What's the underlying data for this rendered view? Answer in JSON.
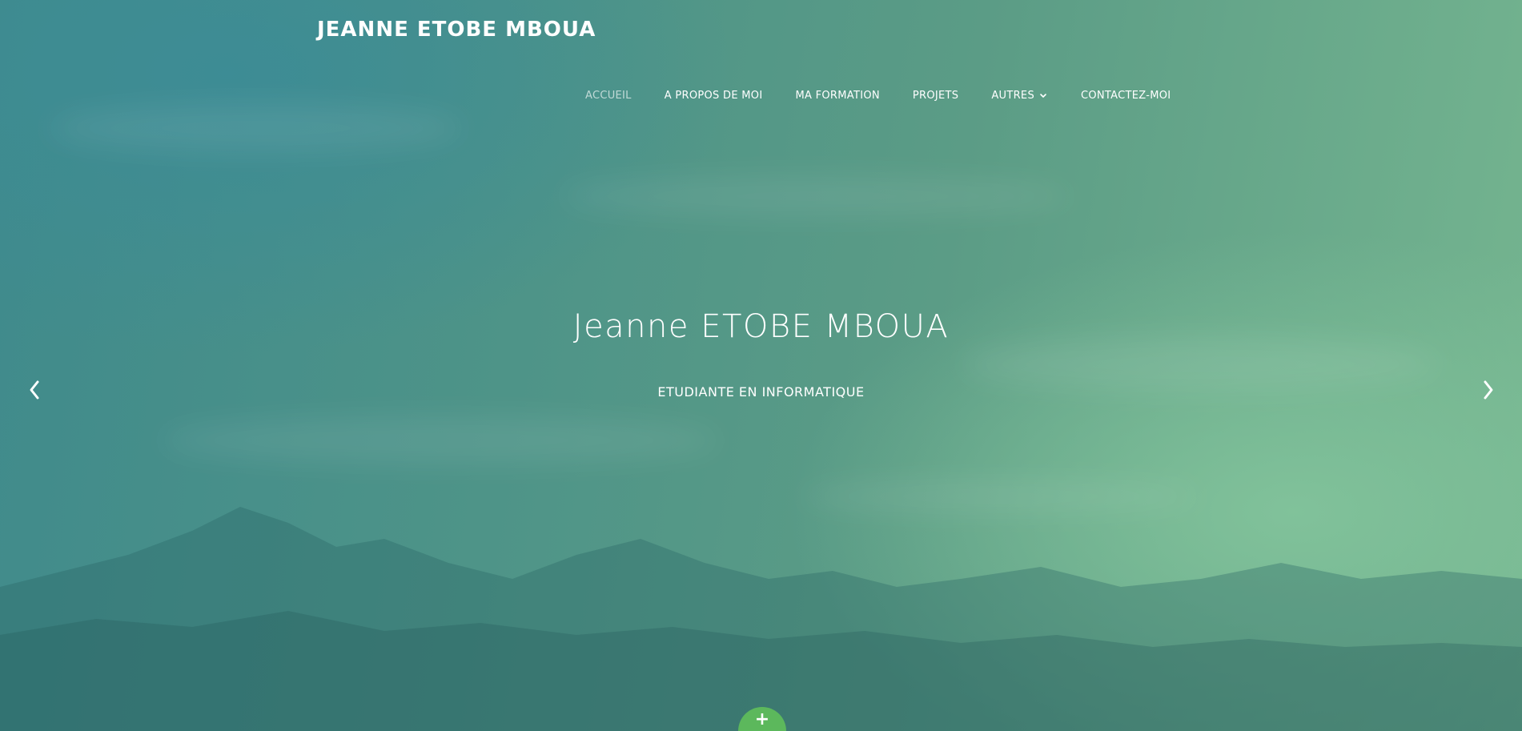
{
  "header": {
    "brand": "JEANNE ETOBE MBOUA"
  },
  "nav": {
    "items": [
      {
        "label": "ACCUEIL",
        "active": true
      },
      {
        "label": "A PROPOS DE MOI",
        "active": false
      },
      {
        "label": "MA FORMATION",
        "active": false
      },
      {
        "label": "PROJETS",
        "active": false
      },
      {
        "label": "AUTRES",
        "active": false,
        "dropdown": true
      },
      {
        "label": "CONTACTEZ-MOI",
        "active": false
      }
    ]
  },
  "hero": {
    "title": "Jeanne ETOBE MBOUA",
    "subtitle": "ETUDIANTE EN INFORMATIQUE"
  },
  "controls": {
    "prev_icon": "chevron-left-icon",
    "next_icon": "chevron-right-icon",
    "more_label": "+"
  },
  "colors": {
    "accent": "#5cb85c",
    "nav_active": "#a9cfc6",
    "text": "#ffffff"
  }
}
